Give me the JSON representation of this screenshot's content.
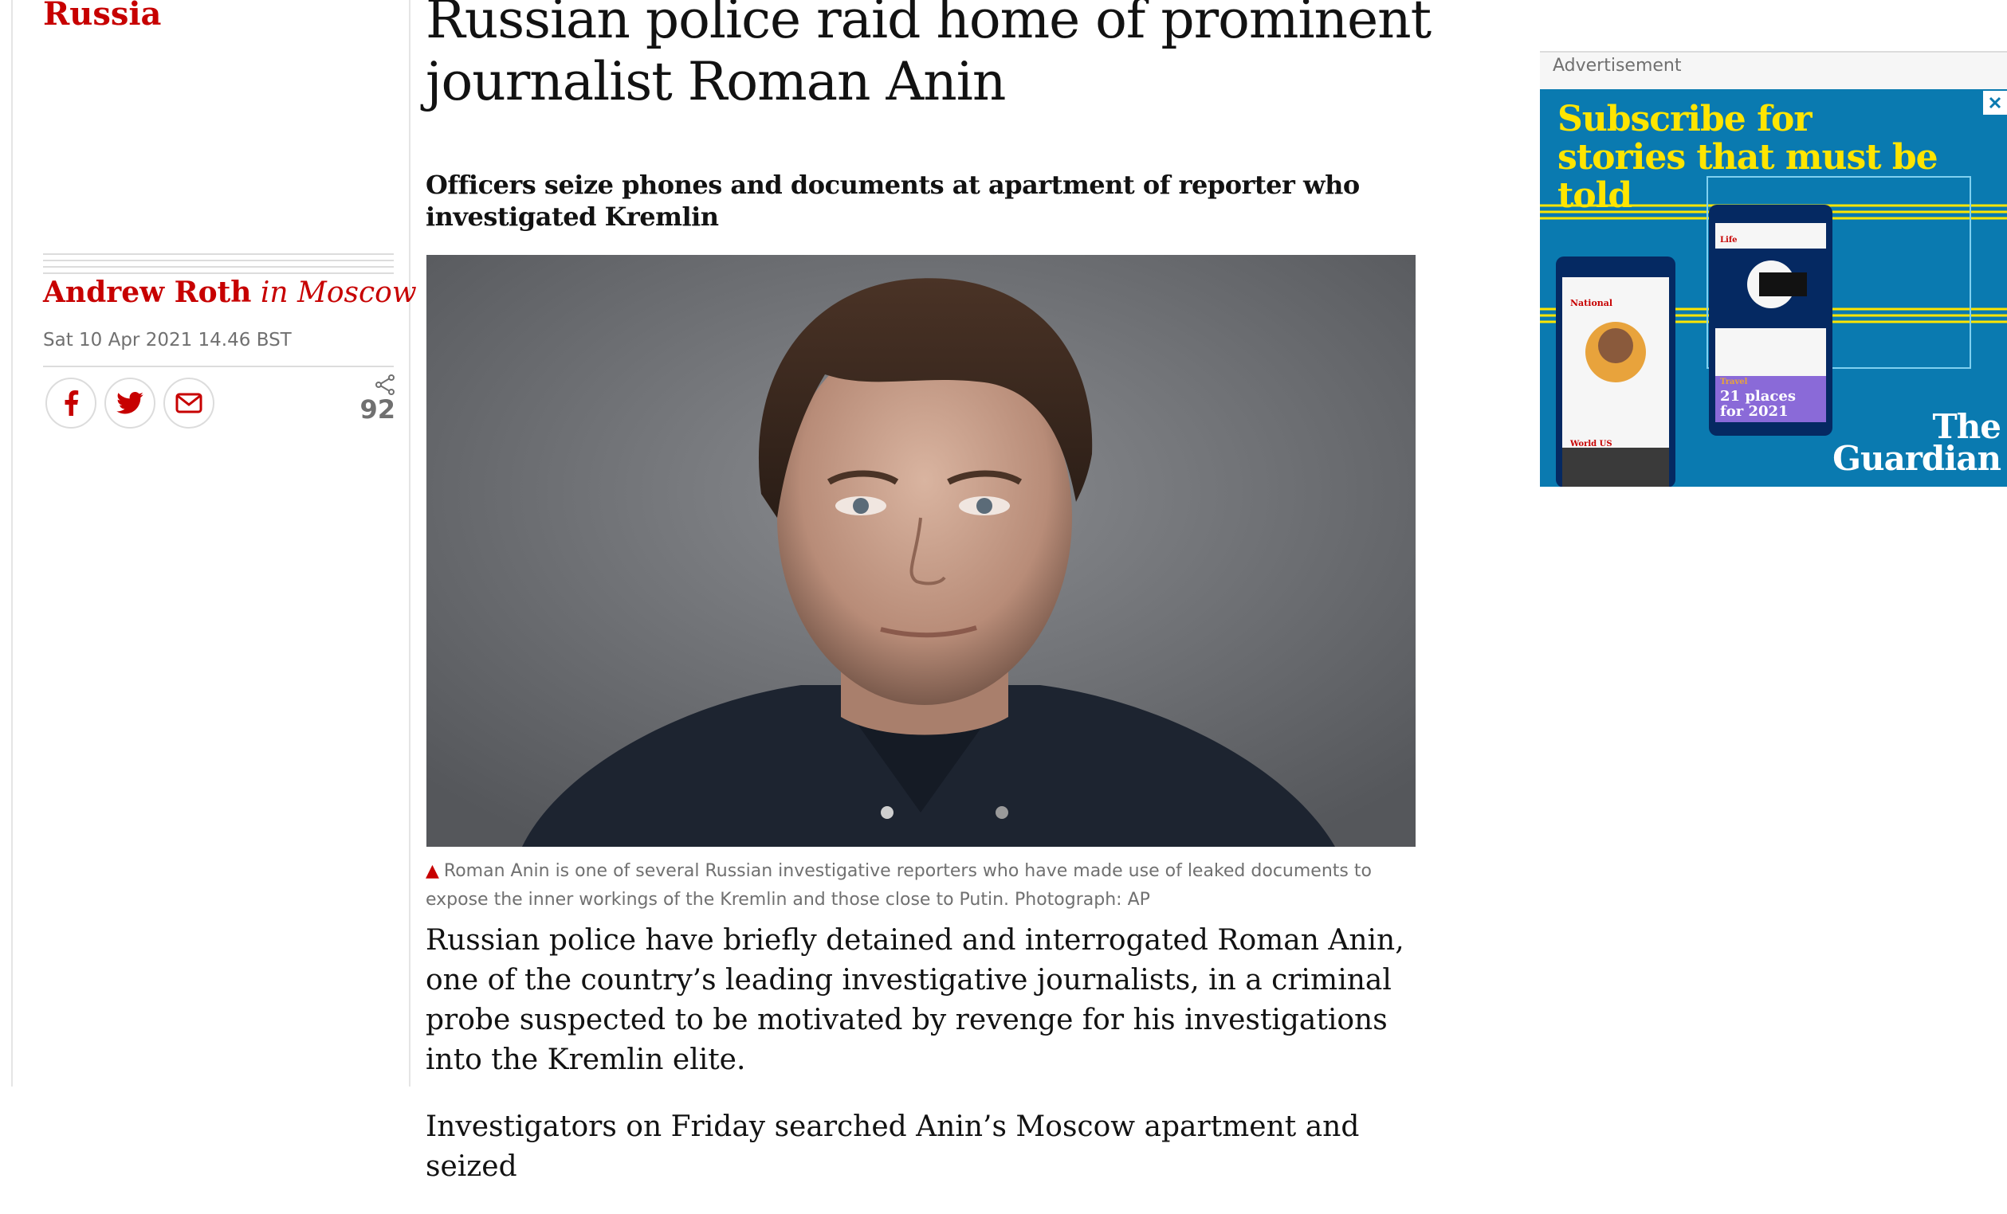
{
  "article": {
    "section": "Russia",
    "headline": "Russian police raid home of prominent journalist Roman Anin",
    "standfirst": "Officers seize phones and documents at apartment of reporter who investigated Kremlin",
    "author_name": "Andrew Roth",
    "author_location": "in Moscow",
    "dateline": "Sat 10 Apr 2021 14.46 BST",
    "share_count": "92",
    "caption_text": "Roman Anin is one of several Russian investigative reporters who have made use of leaked documents to expose the inner workings of the Kremlin and those close to Putin. Photograph: AP",
    "body_paragraphs": [
      "Russian police have briefly detained and interrogated Roman Anin, one of the country’s leading investigative journalists, in a criminal probe suspected to be motivated by revenge for his investigations into the Kremlin elite.",
      "Investigators on Friday searched Anin’s Moscow apartment and seized"
    ]
  },
  "share_buttons": {
    "facebook_icon": "facebook-icon",
    "twitter_icon": "twitter-icon",
    "email_icon": "email-icon",
    "share_icon": "share-icon"
  },
  "advert": {
    "label": "Advertisement",
    "headline": "Subscribe for stories that must be told",
    "logo_line1": "The",
    "logo_line2": "Guardian",
    "phone_left_section": "National",
    "phone_right_section": "Life",
    "phone_right_promo": "21 places for 2021",
    "phone_right_tag": "Travel",
    "phone_left_tag": "World US",
    "close_icon": "close-icon"
  },
  "colors": {
    "brand_red": "#c70000",
    "ad_blue": "#0a7ab0",
    "ad_yellow": "#ffe500",
    "ad_navy": "#052962"
  }
}
